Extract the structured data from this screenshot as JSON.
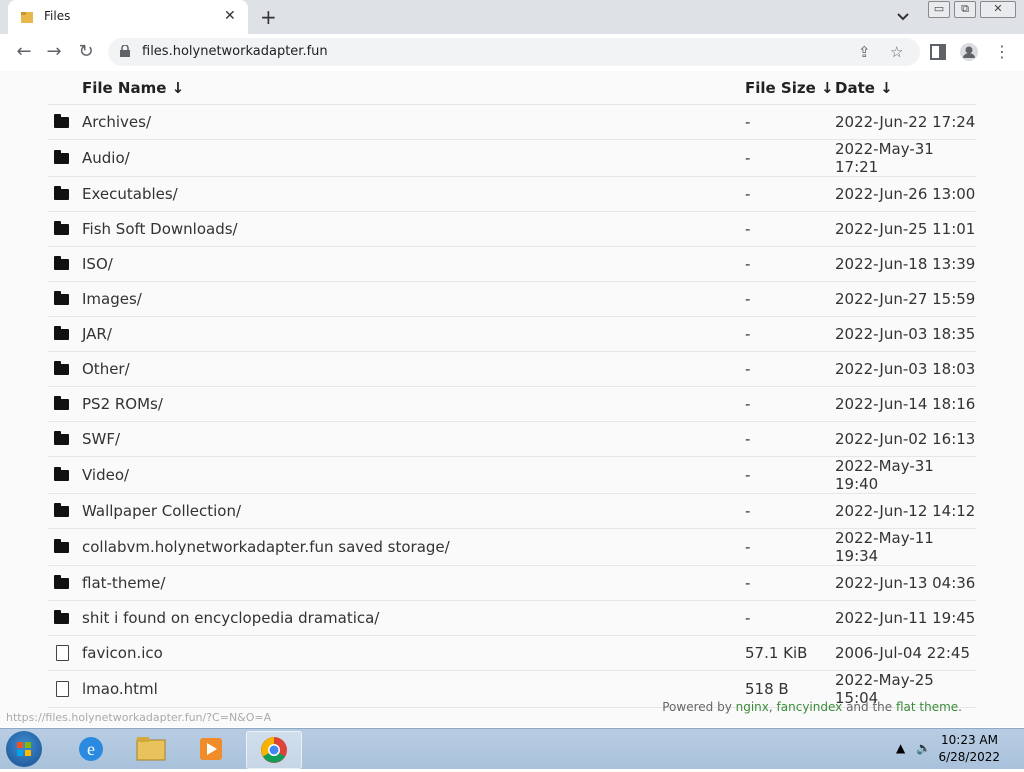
{
  "browser": {
    "tab_title": "Files",
    "tab_close": "✕",
    "new_tab": "+",
    "url": "files.holynetworkadapter.fun",
    "window_buttons": [
      "▭",
      "⧉",
      "✕"
    ]
  },
  "table": {
    "headers": [
      "File Name  ↓",
      "File Size  ↓",
      "Date  ↓"
    ],
    "rows": [
      {
        "type": "folder",
        "name": "Archives/",
        "size": "-",
        "date": "2022-Jun-22 17:24"
      },
      {
        "type": "folder",
        "name": "Audio/",
        "size": "-",
        "date": "2022-May-31 17:21"
      },
      {
        "type": "folder",
        "name": "Executables/",
        "size": "-",
        "date": "2022-Jun-26 13:00"
      },
      {
        "type": "folder",
        "name": "Fish Soft Downloads/",
        "size": "-",
        "date": "2022-Jun-25 11:01"
      },
      {
        "type": "folder",
        "name": "ISO/",
        "size": "-",
        "date": "2022-Jun-18 13:39"
      },
      {
        "type": "folder",
        "name": "Images/",
        "size": "-",
        "date": "2022-Jun-27 15:59"
      },
      {
        "type": "folder",
        "name": "JAR/",
        "size": "-",
        "date": "2022-Jun-03 18:35"
      },
      {
        "type": "folder",
        "name": "Other/",
        "size": "-",
        "date": "2022-Jun-03 18:03"
      },
      {
        "type": "folder",
        "name": "PS2 ROMs/",
        "size": "-",
        "date": "2022-Jun-14 18:16"
      },
      {
        "type": "folder",
        "name": "SWF/",
        "size": "-",
        "date": "2022-Jun-02 16:13"
      },
      {
        "type": "folder",
        "name": "Video/",
        "size": "-",
        "date": "2022-May-31 19:40"
      },
      {
        "type": "folder",
        "name": "Wallpaper Collection/",
        "size": "-",
        "date": "2022-Jun-12 14:12"
      },
      {
        "type": "folder",
        "name": "collabvm.holynetworkadapter.fun saved storage/",
        "size": "-",
        "date": "2022-May-11 19:34"
      },
      {
        "type": "folder",
        "name": "flat-theme/",
        "size": "-",
        "date": "2022-Jun-13 04:36"
      },
      {
        "type": "folder",
        "name": "shit i found on encyclopedia dramatica/",
        "size": "-",
        "date": "2022-Jun-11 19:45"
      },
      {
        "type": "file",
        "name": "favicon.ico",
        "size": "57.1 KiB",
        "date": "2006-Jul-04 22:45"
      },
      {
        "type": "file",
        "name": "lmao.html",
        "size": "518 B",
        "date": "2022-May-25 15:04"
      }
    ]
  },
  "footer": {
    "prefix": "Powered by ",
    "nginx": "nginx",
    "comma": ", ",
    "fancyindex": "fancyindex",
    "mid": " and the ",
    "theme": "flat theme",
    "suffix": "."
  },
  "status_url": "https://files.holynetworkadapter.fun/?C=N&O=A",
  "taskbar": {
    "time": "10:23 AM",
    "date": "6/28/2022"
  }
}
